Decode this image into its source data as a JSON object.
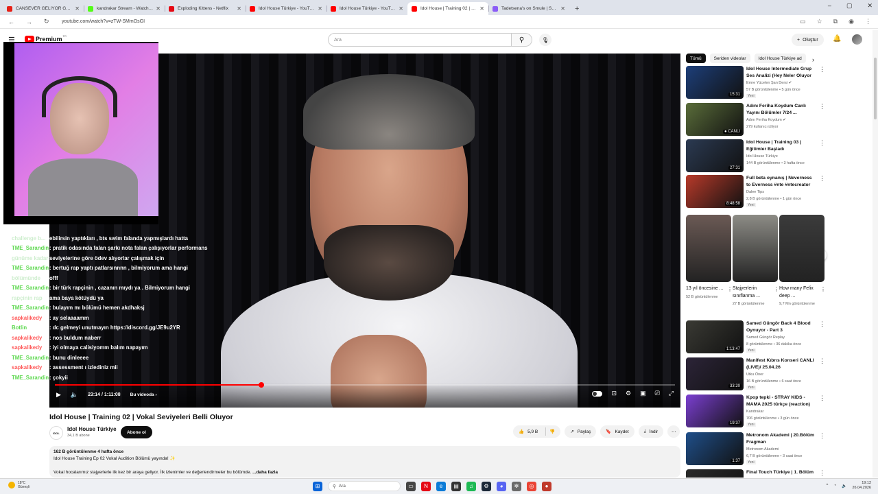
{
  "browser": {
    "tabs": [
      {
        "title": "CANSEVER GELIYOR GELIYOR !!",
        "color": "#e62117",
        "active": false
      },
      {
        "title": "kandrakar Stream - Watch Live",
        "color": "#53fc18",
        "active": false
      },
      {
        "title": "Exploding Kittens - Netflix",
        "color": "#e50914",
        "active": false
      },
      {
        "title": "Idol House Türkiye - YouTube",
        "color": "#ff0000",
        "active": false
      },
      {
        "title": "Idol House Türkiye - YouTube",
        "color": "#ff0000",
        "active": false
      },
      {
        "title": "Idol House | Training 02 | Vokal",
        "color": "#ff0000",
        "active": true
      },
      {
        "title": "Tadetsena's on Smule | Smule S",
        "color": "#8b5cf6",
        "active": false
      }
    ],
    "new_tab": "+",
    "url": "youtube.com/watch?v=zTW-SMmOsGI",
    "window_controls": {
      "minimize": "–",
      "maximize": "▢",
      "close": "✕"
    }
  },
  "youtube": {
    "logo_text": "Premium",
    "logo_badge": "TR",
    "search_placeholder": "Ara",
    "create_label": "Oluştur"
  },
  "chat": [
    {
      "user": "",
      "msg": "",
      "ucolor": "#ffffff"
    },
    {
      "user": "challenge b...",
      "msg": "ebilirsin yaptıkları , bts swim falanda yapmışlardı hatta",
      "ucolor": "#cfeecf"
    },
    {
      "user": "TME_Sarandin",
      "msg": ": pratik odasında falan şarkı nota falan çalışıyorlar performans",
      "ucolor": "#5dd84f"
    },
    {
      "user": "günüme kadar",
      "msg": "seviyelerine göre ödev alıyorlar çalışmak için",
      "ucolor": "#cfeecf"
    },
    {
      "user": "TME_Sarandin",
      "msg": ": bertuğ rap yaptı patlarsınnnn , bilmiyorum ama hangi",
      "ucolor": "#5dd84f"
    },
    {
      "user": "bölümünde",
      "msg": "offf",
      "ucolor": "#cfeecf"
    },
    {
      "user": "TME_Sarandin",
      "msg": ": bir türk rapçinin , cazanın mıydı ya . Bilmiyorum hangi",
      "ucolor": "#5dd84f"
    },
    {
      "user": "rapçinin rap",
      "msg": "ama baya kötüydü ya",
      "ucolor": "#cfeecf"
    },
    {
      "user": "TME_Sarandin",
      "msg": ": bulayım mı bölümü hemen akdhaksj",
      "ucolor": "#5dd84f"
    },
    {
      "user": "sapkalikedy",
      "msg": ": ay selaaaamm",
      "ucolor": "#ff5b5b"
    },
    {
      "user": "Botlin",
      "msg": ": dc gelmeyi unutmayın https://discord.gg/JE9u2YR",
      "ucolor": "#5dd84f"
    },
    {
      "user": "sapkalikedy",
      "msg": ": nos buldum naberr",
      "ucolor": "#ff5b5b"
    },
    {
      "user": "sapkalikedy",
      "msg": ": iyi olmaya calisiyomm balım napayım",
      "ucolor": "#ff5b5b"
    },
    {
      "user": "TME_Sarandin",
      "msg": ": bunu dinleeee",
      "ucolor": "#5dd84f"
    },
    {
      "user": "sapkalikedy",
      "msg": ": assessment ı izlediniz mii",
      "ucolor": "#ff5b5b"
    },
    {
      "user": "TME_Sarandin",
      "msg": ": çokyii",
      "ucolor": "#5dd84f"
    }
  ],
  "player": {
    "progress_fraction": 0.333,
    "time": "23:14 / 1:11:08",
    "chapter": "Bu videoda"
  },
  "video": {
    "title": "Idol House | Training 02 | Vokal Seviyeleri Belli Oluyor",
    "channel": "Idol House Türkiye",
    "channel_avatar_text": "IDOL",
    "subscribers": "34,1 B abone",
    "subscribe_label": "Abone ol",
    "likes": "5,9 B",
    "share_label": "Paylaş",
    "save_label": "Kaydet",
    "download_label": "İndir",
    "views_date": "162 B görüntülenme  4 hafta önce",
    "desc_line1": "Idol House Training Ep 02 Vokal Audition Bölümü yayında! ✨",
    "desc_line2": "Vokal hocalarımız stajyerlerle ilk kez bir araya geliyor. İlk izlenimler ve değerlendirmeler bu bölümde.",
    "desc_more": "...daha fazla"
  },
  "sidebar": {
    "chips": [
      "Tümü",
      "Seriden videolar",
      "Idol House Türkiye ad"
    ],
    "recs": [
      {
        "title": "Idol House Intermediate Grup Ses Analizi (Hey Neler Oluyor ...",
        "channel": "Emre Yücelen Şan Dersi ✔",
        "views": "57 B görüntülenme • 5 gün önce",
        "badge": "Yeni",
        "dur": "15:31",
        "bg": "#1d3f7a"
      },
      {
        "title": "Adını Feriha Koydum Canlı Yayını Bölümler 7/24 ...",
        "channel": "Adını Feriha Koydum ✔",
        "views": "279 kullanıcı izliyor",
        "badge": "",
        "dur": "● CANLI",
        "bg": "#5a6d3a"
      },
      {
        "title": "Idol House | Training 03 | Eğitimler Başladı",
        "channel": "Idol House Türkiye",
        "views": "144 B görüntülenme • 3 hafta önce",
        "badge": "",
        "dur": "27:31",
        "bg": "#2b3a52"
      },
      {
        "title": "Full beta oynanış | Neverness to Everness #nte #ntecreator ...",
        "channel": "Dalee Tips",
        "views": "2,8 B görüntülenme • 1 gün önce",
        "badge": "Yeni",
        "dur": "8:48:58",
        "bg": "#b83a2a"
      },
      {
        "title": "Samed Güngör Back 4 Blood Oynuyor - Part 3",
        "channel": "Samed Güngör Replay",
        "views": "8 görüntülenme • 36 dakika önce",
        "badge": "Yeni",
        "dur": "1:13:47",
        "bg": "#3a3a34"
      },
      {
        "title": "Manifest Kıbrıs Konseri CANLI (LIVE)/ 25.04.26 @m6nifestgirls",
        "channel": "Utku Öner",
        "views": "16 B görüntülenme • 6 saat önce",
        "badge": "Yeni",
        "dur": "33:20",
        "bg": "#2c2438"
      },
      {
        "title": "Kpop tepki - STRAY KIDS - MAMA 2025 türkçe (reaction)",
        "channel": "Kandrakar",
        "views": "706 görüntülenme • 3 gün önce",
        "badge": "Yeni",
        "dur": "19:37",
        "bg": "#7b3fd1"
      },
      {
        "title": "Metronom Akademi | 20.Bölüm Fragman",
        "channel": "Metronom Akademi",
        "views": "6,7 B görüntülenme • 3 saat önce",
        "badge": "Yeni",
        "dur": "1:37",
        "bg": "#1f4f8a"
      },
      {
        "title": "Final Touch Türkiye | 1. Bölüm :",
        "channel": "",
        "views": "",
        "badge": "",
        "dur": "",
        "bg": "#2a2a2a"
      }
    ],
    "shorts": [
      {
        "title": "13 yıl öncesine ...",
        "views": "52 B görüntülenme",
        "bg": "#6b5a55"
      },
      {
        "title": "Stajyerlerin sınıflanma ...",
        "views": "27 B görüntülenme",
        "bg": "#8d8c86"
      },
      {
        "title": "How many Felix deep ...",
        "views": "9,7 Mn görüntülenme",
        "bg": "#3b3b3b"
      }
    ]
  },
  "taskbar": {
    "temp": "18°C",
    "condition": "Güneşli",
    "search": "Ara",
    "time": "19:12",
    "date": "26.04.2026"
  }
}
